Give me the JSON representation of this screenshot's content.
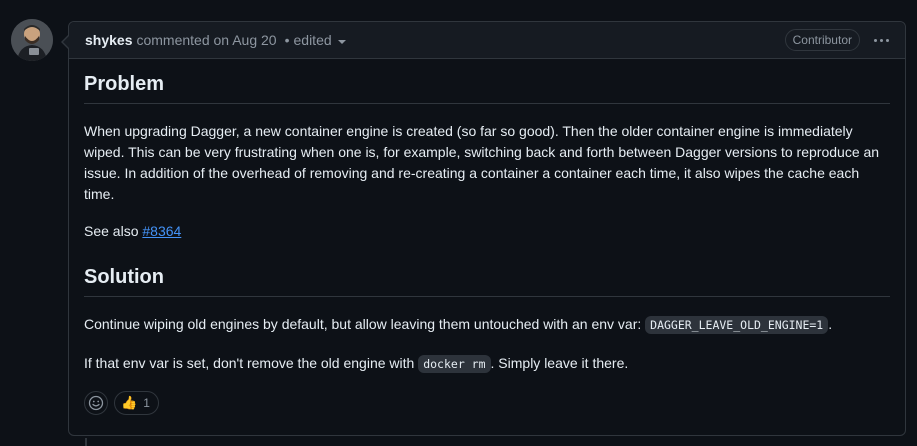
{
  "comment": {
    "author": "shykes",
    "action": "commented on Aug 20",
    "separator": "•",
    "edited_label": "edited",
    "role_badge": "Contributor"
  },
  "body": {
    "heading_problem": "Problem",
    "problem_text": "When upgrading Dagger, a new container engine is created (so far so good). Then the older container engine is immediately wiped. This can be very frustrating when one is, for example, switching back and forth between Dagger versions to reproduce an issue. In addition of the overhead of removing and re-creating a container a container each time, it also wipes the cache each time.",
    "see_also_prefix": "See also",
    "see_also_link": "#8364",
    "heading_solution": "Solution",
    "solution_text_before": "Continue wiping old engines by default, but allow leaving them untouched with an env var:",
    "solution_code": "DAGGER_LEAVE_OLD_ENGINE=1",
    "solution_text_after": ".",
    "solution2_before": "If that env var is set, don't remove the old engine with",
    "solution2_code": "docker rm",
    "solution2_after": ". Simply leave it there."
  },
  "reactions": {
    "items": [
      {
        "emoji": "👍",
        "count": "1"
      }
    ]
  },
  "icons": {
    "avatar": "avatar",
    "dropdown": "chevron-down-icon",
    "more": "kebab-horizontal-icon",
    "emoji_picker": "smiley-icon"
  },
  "colors": {
    "background": "#0d1117",
    "header_bg": "#161b22",
    "border": "#30363d",
    "link": "#4493f8",
    "text": "#e6edf3",
    "muted": "#8d96a0"
  }
}
